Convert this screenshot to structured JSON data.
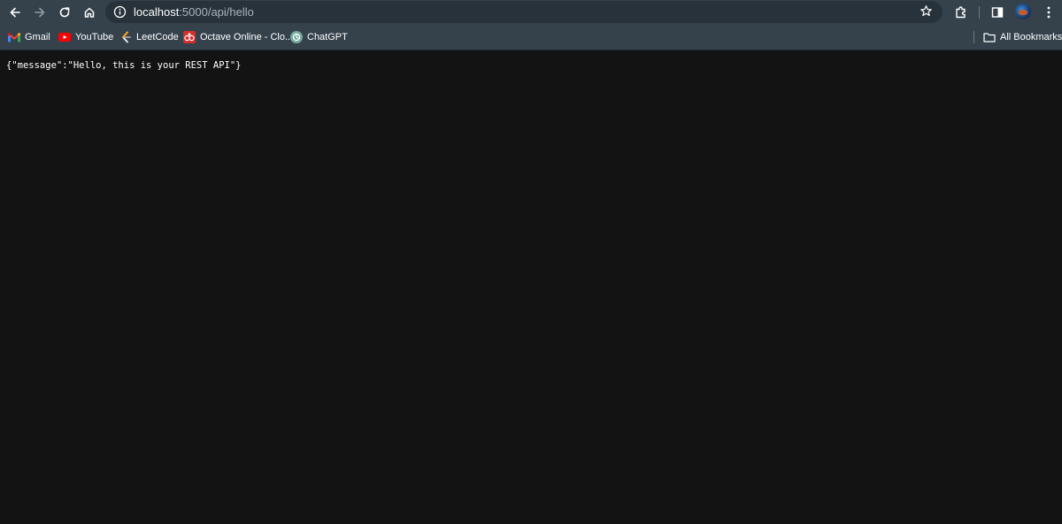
{
  "browser": {
    "address_bar": {
      "host": "localhost",
      "path": ":5000/api/hello"
    },
    "bookmarks": [
      {
        "label": "Gmail",
        "icon": "gmail-icon"
      },
      {
        "label": "YouTube",
        "icon": "youtube-icon"
      },
      {
        "label": "LeetCode",
        "icon": "leetcode-icon"
      },
      {
        "label": "Octave Online - Clo...",
        "icon": "octave-icon"
      },
      {
        "label": "ChatGPT",
        "icon": "chatgpt-icon"
      }
    ],
    "all_bookmarks_label": "All Bookmarks",
    "colors": {
      "toolbar": "#35424c",
      "omnibox": "#27323a",
      "page_background": "#131313",
      "page_text": "#ffffff"
    }
  },
  "page": {
    "raw_json": "{\"message\":\"Hello, this is your REST API\"}"
  }
}
